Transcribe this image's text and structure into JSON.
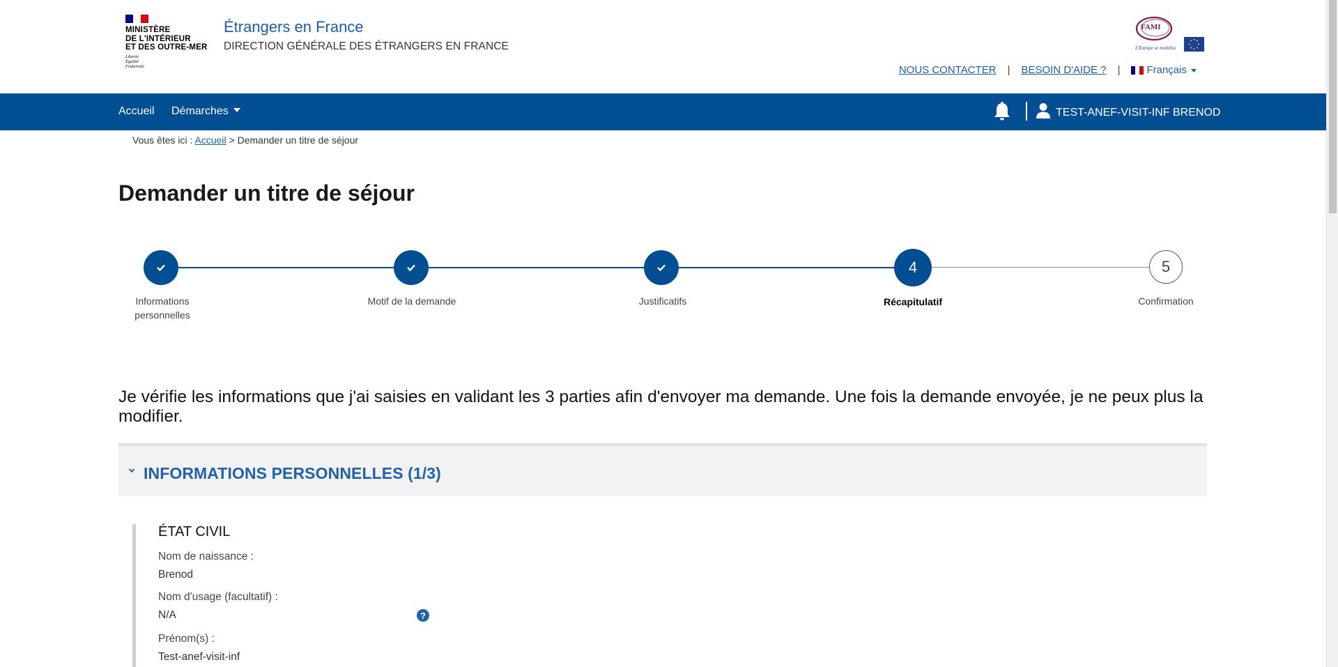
{
  "header": {
    "ministry_lines": [
      "MINISTÈRE",
      "DE L'INTÉRIEUR",
      "ET DES OUTRE-MER"
    ],
    "motto_lines": [
      "Liberté",
      "Égalité",
      "Fraternité"
    ],
    "site_title": "Étrangers en France",
    "site_subtitle": "DIRECTION GÉNÉRALE DES ÉTRANGERS EN FRANCE",
    "contact_link": "NOUS CONTACTER",
    "separator": "|",
    "help_link": "BESOIN D'AIDE ?",
    "language": "Français",
    "partner_logo": {
      "name": "FAMI",
      "tagline": "L'Europe se mobilise"
    }
  },
  "navbar": {
    "home": "Accueil",
    "procedures": "Démarches",
    "user_name": "TEST-ANEF-VISIT-INF BRENOD",
    "bell_icon": "bell-icon",
    "user_icon": "user-icon"
  },
  "breadcrumb": {
    "prefix": "Vous êtes ici : ",
    "home": "Accueil",
    "separator": " > ",
    "current": "Demander un titre de séjour"
  },
  "page_title": "Demander un titre de séjour",
  "stepper": {
    "steps": [
      {
        "label_lines": [
          "Informations",
          "personnelles"
        ],
        "state": "done"
      },
      {
        "label_lines": [
          "Motif de la demande"
        ],
        "state": "done"
      },
      {
        "label_lines": [
          "Justificatifs"
        ],
        "state": "done"
      },
      {
        "label_lines": [
          "Récapitulatif"
        ],
        "state": "current",
        "number": "4"
      },
      {
        "label_lines": [
          "Confirmation"
        ],
        "state": "todo",
        "number": "5"
      }
    ]
  },
  "intro": "Je vérifie les informations que j'ai saisies en validant les 3 parties afin d'envoyer ma demande. Une fois la demande envoyée, je ne peux plus la modifier.",
  "accordion": {
    "title": "INFORMATIONS PERSONNELLES (1/3)",
    "section_title": "ÉTAT CIVIL",
    "fields": [
      {
        "label": "Nom de naissance :",
        "value": "Brenod"
      },
      {
        "label": "Nom d'usage (facultatif) :",
        "value": "N/A"
      },
      {
        "label": "Prénom(s) :",
        "value": "Test-anef-visit-inf"
      }
    ],
    "help_glyph": "?"
  },
  "colors": {
    "primary_blue": "#014f92",
    "link_blue": "#1b5fa8",
    "accordion_title": "#1f62ab",
    "accordion_bg": "#f2f2f2"
  }
}
